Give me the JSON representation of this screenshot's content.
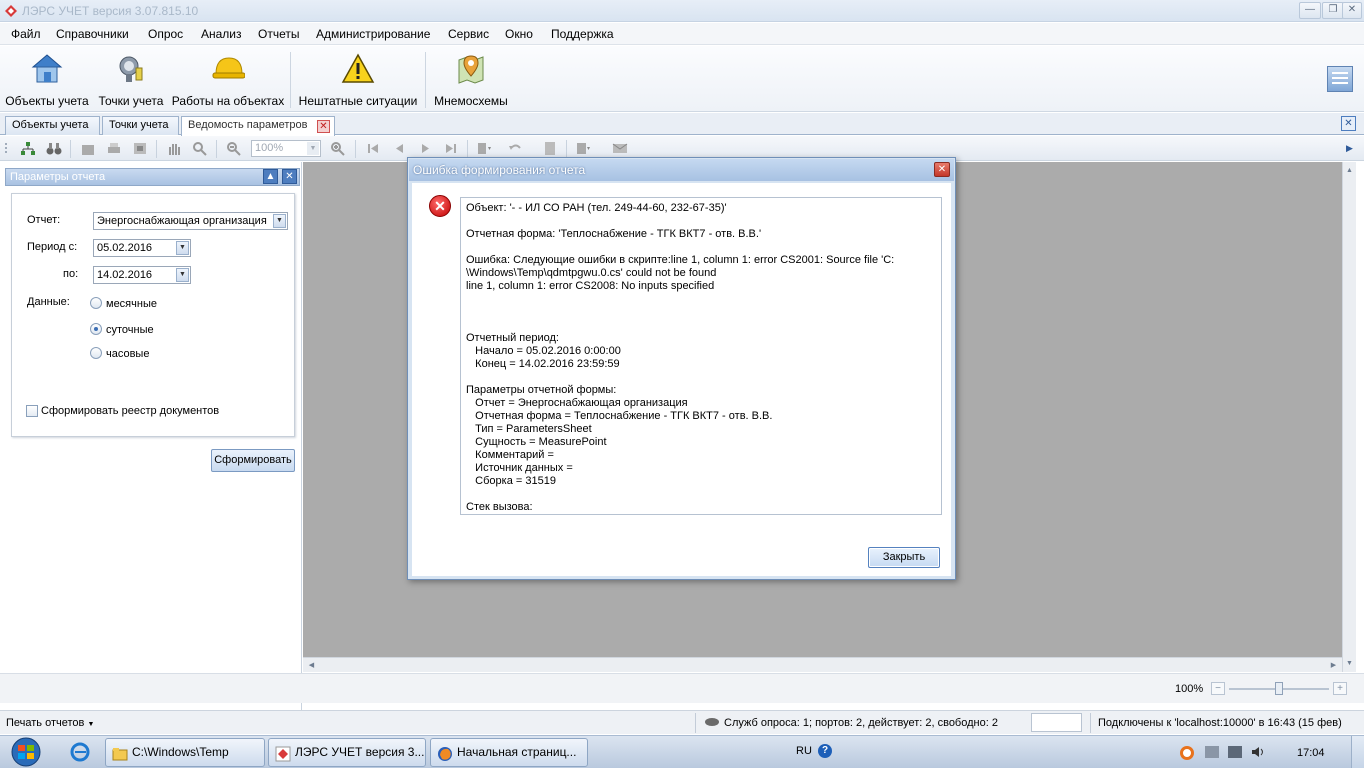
{
  "window": {
    "title": "ЛЭРС УЧЕТ версия 3.07.815.10"
  },
  "menu": [
    "Файл",
    "Справочники",
    "Опрос",
    "Анализ",
    "Отчеты",
    "Администрирование",
    "Сервис",
    "Окно",
    "Поддержка"
  ],
  "ribbon": {
    "buttons": [
      {
        "label": "Объекты учета",
        "icon": "house-icon"
      },
      {
        "label": "Точки учета",
        "icon": "meter-icon"
      },
      {
        "label": "Работы на объектах",
        "icon": "hard-hat-icon"
      },
      {
        "label": "Нештатные ситуации",
        "icon": "warning-icon"
      },
      {
        "label": "Мнемосхемы",
        "icon": "map-pin-icon"
      }
    ]
  },
  "tabs": [
    {
      "label": "Объекты учета"
    },
    {
      "label": "Точки учета"
    },
    {
      "label": "Ведомость параметров",
      "active": true
    }
  ],
  "toolbar": {
    "zoom_value": "100%"
  },
  "params_panel": {
    "title": "Параметры отчета",
    "report_label": "Отчет:",
    "report_value": "Энергоснабжающая организация",
    "period_from_label": "Период с:",
    "period_from_value": "05.02.2016",
    "period_to_label": "по:",
    "period_to_value": "14.02.2016",
    "data_label": "Данные:",
    "options": [
      "месячные",
      "суточные",
      "часовые"
    ],
    "selected_option": "суточные",
    "register_checkbox_label": "Сформировать реестр документов",
    "register_checked": false,
    "submit_label": "Сформировать"
  },
  "dialog": {
    "title": "Ошибка формирования отчета",
    "lines": [
      "Объект: '- - ИЛ СО РАН (тел. 249-44-60, 232-67-35)'",
      "",
      "Отчетная форма: 'Теплоснабжение - ТГК ВКТ7 - отв. В.В.'",
      "",
      "Ошибка: Следующие ошибки в скрипте:line 1, column 1: error CS2001: Source file 'C:",
      "\\Windows\\Temp\\qdmtpgwu.0.cs' could not be found",
      "line 1, column 1: error CS2008: No inputs specified",
      "",
      "",
      "",
      "Отчетный период:",
      "   Начало = 05.02.2016 0:00:00",
      "   Конец = 14.02.2016 23:59:59",
      "",
      "Параметры отчетной формы:",
      "   Отчет = Энергоснабжающая организация",
      "   Отчетная форма = Теплоснабжение - ТГК ВКТ7 - отв. В.В.",
      "   Тип = ParametersSheet",
      "   Сущность = MeasurePoint",
      "   Комментарий =",
      "   Источник данных =",
      "   Сборка = 31519",
      "",
      "Стек вызова:"
    ],
    "close_button": "Закрыть"
  },
  "zoom": {
    "value": "100%",
    "level": 0.5
  },
  "status": {
    "print_reports": "Печать отчетов",
    "services": "Служб опроса: 1; портов: 2, действует: 2, свободно: 2",
    "connection": "Подключены к 'localhost:10000' в 16:43 (15 фев)"
  },
  "taskbar": {
    "items": [
      {
        "label": "C:\\Windows\\Temp",
        "icon": "folder-icon"
      },
      {
        "label": "ЛЭРС УЧЕТ версия 3...",
        "icon": "app-icon"
      },
      {
        "label": "Начальная страниц...",
        "icon": "firefox-icon"
      }
    ],
    "lang": "RU",
    "clock": "17:04"
  }
}
